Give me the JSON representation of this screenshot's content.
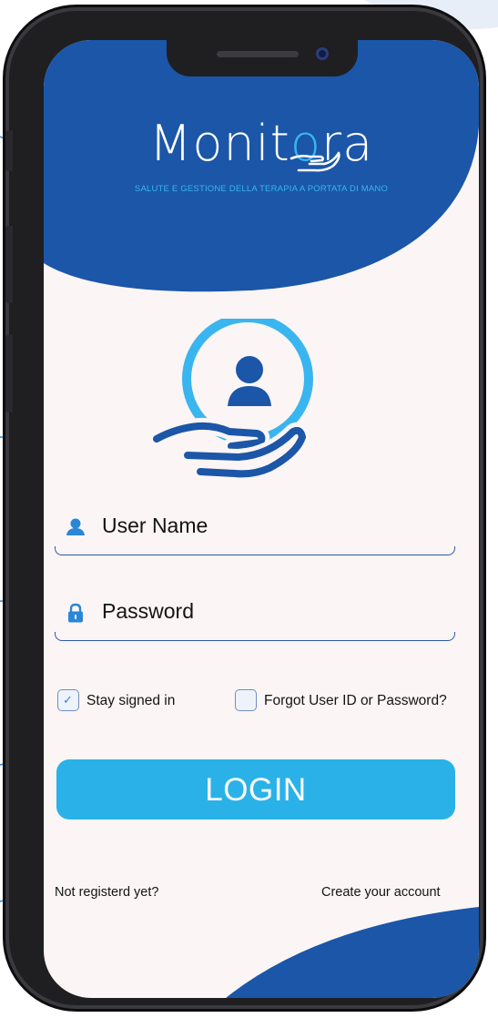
{
  "app": {
    "name": "Monitora",
    "logo_prefix": "Monit",
    "logo_suffix": "ra",
    "tagline": "SALUTE E GESTIONE DELLA TERAPIA  A PORTATA DI MANO"
  },
  "login_form": {
    "username_label": "User Name",
    "password_label": "Password",
    "stay_signed_in_label": "Stay signed in",
    "stay_signed_in_checked": true,
    "forgot_label": "Forgot User ID or Password?",
    "forgot_checked": false,
    "login_button_label": "LOGIN"
  },
  "footer": {
    "not_registered_text": "Not registerd yet?",
    "create_account_text": "Create your account"
  },
  "icons": {
    "user_field": "user-icon",
    "password_field": "lock-icon",
    "hero": "hand-holding-user-icon"
  },
  "colors": {
    "brand_dark_blue": "#1b56a8",
    "brand_light_blue": "#2ab2e8",
    "screen_background": "#fbf5f5",
    "text": "#141414"
  }
}
